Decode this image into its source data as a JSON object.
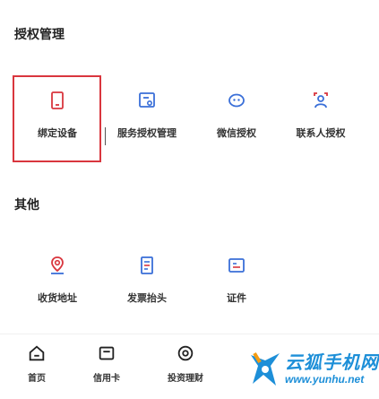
{
  "sections": {
    "auth": {
      "title": "授权管理",
      "items": [
        {
          "label": "绑定设备",
          "icon": "device-icon"
        },
        {
          "label": "服务授权管理",
          "icon": "service-auth-icon"
        },
        {
          "label": "微信授权",
          "icon": "wechat-auth-icon"
        },
        {
          "label": "联系人授权",
          "icon": "contact-auth-icon"
        }
      ]
    },
    "other": {
      "title": "其他",
      "items": [
        {
          "label": "收货地址",
          "icon": "location-pin-icon"
        },
        {
          "label": "发票抬头",
          "icon": "invoice-icon"
        },
        {
          "label": "证件",
          "icon": "id-card-icon"
        }
      ]
    }
  },
  "bottom_nav": [
    {
      "label": "首页",
      "icon": "home-icon"
    },
    {
      "label": "信用卡",
      "icon": "card-icon"
    },
    {
      "label": "投资理财",
      "icon": "wealth-icon"
    }
  ],
  "watermark": {
    "line1": "云狐手机网",
    "line2": "www.yunhu.net"
  },
  "colors": {
    "accent_red": "#d9363e",
    "icon_blue": "#3a6fd8",
    "watermark_blue": "#1d8fd8"
  }
}
